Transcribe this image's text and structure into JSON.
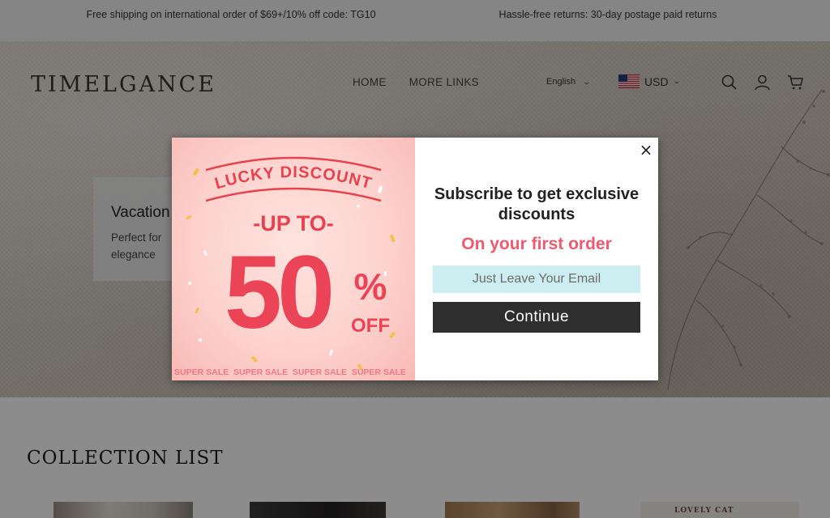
{
  "announcement": {
    "left": "Free shipping on international order of $69+/10% off code: TG10",
    "right": "Hassle-free returns: 30-day postage paid returns"
  },
  "header": {
    "logo": "TIMELGANCE",
    "nav": [
      "HOME",
      "MORE LINKS"
    ],
    "language": "English",
    "currency": "USD",
    "icons": [
      "search-icon",
      "account-icon",
      "cart-icon"
    ]
  },
  "hero": {
    "title": "Vacation",
    "description_line1": "Perfect for",
    "description_line2": "elegance"
  },
  "collection": {
    "heading": "COLLECTION LIST",
    "thumb4_text": "LOVELY CAT"
  },
  "popup": {
    "promo": {
      "banner": "LUCKY DISCOUNT",
      "up_to": "-UP TO-",
      "amount": "50",
      "percent": "%",
      "off": "OFF",
      "footer": "SUPER SALE  SUPER SALE  SUPER SALE  SUPER SALE"
    },
    "close_symbol": "×",
    "title": "Subscribe to get exclusive discounts",
    "accent": "On your first order",
    "email_placeholder": "Just Leave Your Email",
    "button": "Continue"
  },
  "colors": {
    "accent": "#ee5a6e",
    "email_bg": "#cdeef0",
    "button_bg": "#2e2e2e",
    "promo_red": "#e8424f",
    "overlay": "rgba(0,0,0,0.45)"
  }
}
